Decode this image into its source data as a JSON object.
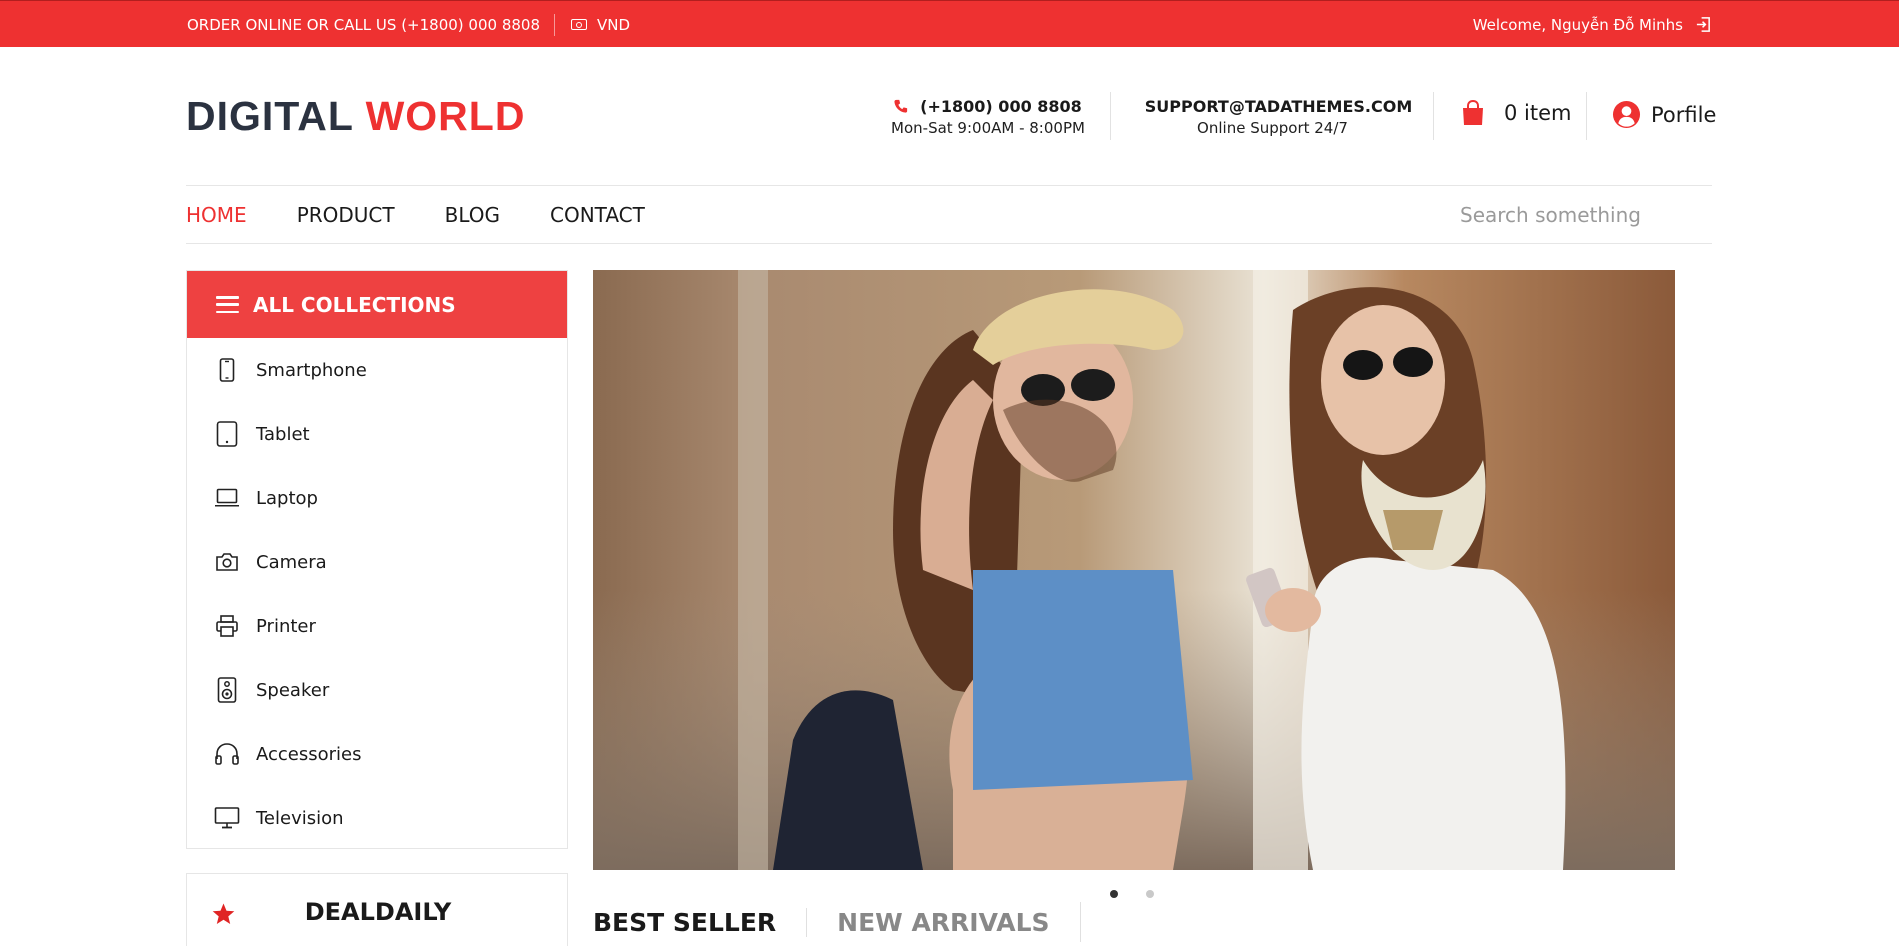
{
  "topbar": {
    "order_text": "ORDER ONLINE OR CALL US (+1800) 000 8808",
    "currency": "VND",
    "welcome": "Welcome, Nguyễn Đỗ Minhs"
  },
  "logo": {
    "part1": "DIGITAL ",
    "part2": "WORLD"
  },
  "header": {
    "phone": "(+1800) 000 8808",
    "phone_hours": "Mon-Sat 9:00AM - 8:00PM",
    "email": "SUPPORT@TADATHEMES.COM",
    "email_sub": "Online Support 24/7",
    "cart_label": "0 item",
    "profile_label": "Porfile"
  },
  "nav": {
    "items": [
      "HOME",
      "PRODUCT",
      "BLOG",
      "CONTACT"
    ],
    "active": "HOME",
    "search_placeholder": "Search something"
  },
  "sidebar": {
    "title": "ALL COLLECTIONS",
    "categories": [
      {
        "label": "Smartphone",
        "icon": "smartphone-icon"
      },
      {
        "label": "Tablet",
        "icon": "tablet-icon"
      },
      {
        "label": "Laptop",
        "icon": "laptop-icon"
      },
      {
        "label": "Camera",
        "icon": "camera-icon"
      },
      {
        "label": "Printer",
        "icon": "printer-icon"
      },
      {
        "label": "Speaker",
        "icon": "speaker-icon"
      },
      {
        "label": "Accessories",
        "icon": "headphones-icon"
      },
      {
        "label": "Television",
        "icon": "monitor-icon"
      }
    ]
  },
  "deal": {
    "title": "DEALDAILY"
  },
  "tabs": {
    "best_seller": "BEST SELLER",
    "new_arrivals": "NEW ARRIVALS"
  },
  "colors": {
    "brand_red": "#ee3131",
    "logo_dark": "#2b3240"
  }
}
